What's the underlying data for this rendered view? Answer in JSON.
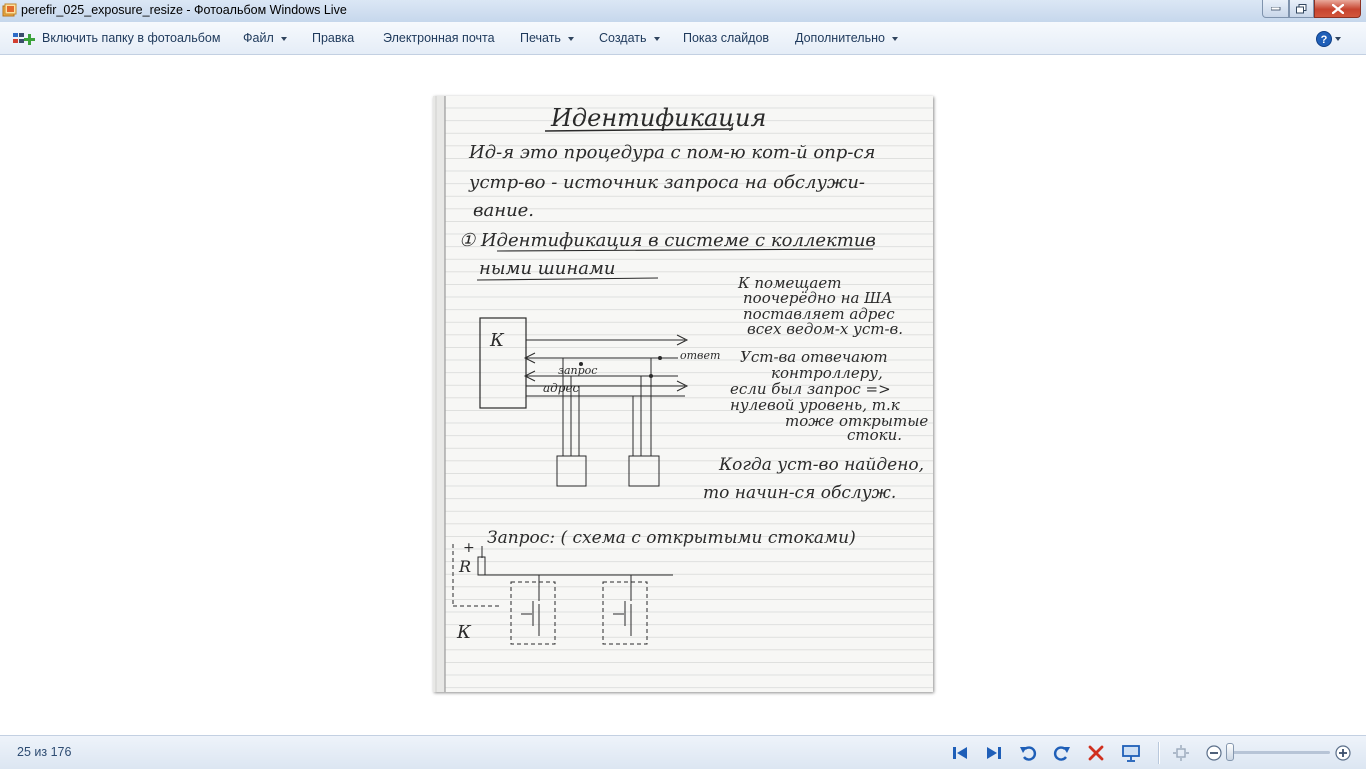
{
  "window": {
    "title": "perefir_025_exposure_resize - Фотоальбом Windows Live"
  },
  "menu": {
    "include_folder": "Включить папку в фотоальбом",
    "file": "Файл",
    "edit": "Правка",
    "email": "Электронная почта",
    "print": "Печать",
    "create": "Создать",
    "slideshow": "Показ слайдов",
    "extras": "Дополнительно"
  },
  "photo": {
    "notes": {
      "title": "Идентификация",
      "line1": "Ид-я это процедура с пом-ю кот-й опр-ся",
      "line2": "устр-во - источник запроса на обслужи-",
      "line3": "вание.",
      "point1a": "① Идентификация в системе с коллектив",
      "point1b": "ными шинами",
      "side1": "К помещает",
      "side2": "поочерёдно на ША",
      "side3": "поставляет адрес",
      "side4": "всех ведом-х уст-в.",
      "side5": "Уст-ва отвечают",
      "side6": "контроллеру,",
      "side7": "если был запрос =>",
      "side8": "нулевой уровень, т.к",
      "side9": "тоже открытые",
      "side10": "стоки.",
      "found1": "Когда уст-во найдено,",
      "found2": "то начин-ся обслуж.",
      "request": "Запрос: ( схема с открытыми стоками)",
      "lbl_k": "К",
      "lbl_answer": "ответ",
      "lbl_request": "запрос",
      "lbl_address": "адрес",
      "lbl_k2": "К",
      "lbl_r": "R",
      "lbl_plus": "+"
    }
  },
  "status": {
    "counter": "25 из 176"
  }
}
